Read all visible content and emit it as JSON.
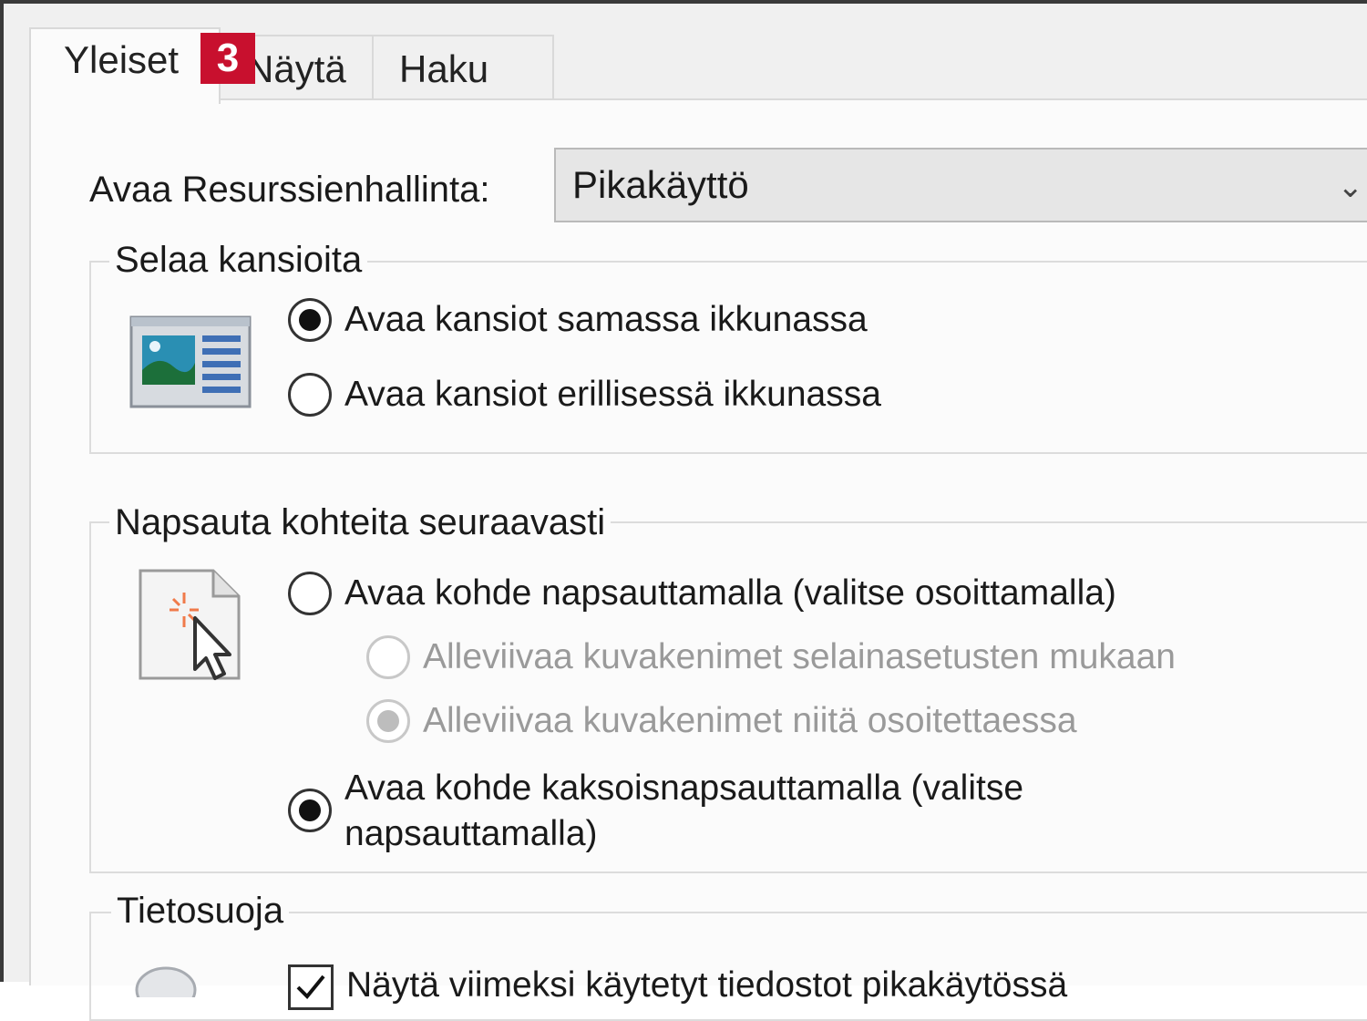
{
  "tabs": [
    {
      "label": "Yleiset",
      "active": true
    },
    {
      "label": "Näytä",
      "active": false
    },
    {
      "label": "Haku",
      "active": false
    }
  ],
  "badge": "3",
  "open_explorer": {
    "label": "Avaa Resurssienhallinta:",
    "selected": "Pikakäyttö"
  },
  "browse_folders": {
    "legend": "Selaa kansioita",
    "icon": "folder-window-icon",
    "options": [
      {
        "label": "Avaa kansiot samassa ikkunassa",
        "checked": true
      },
      {
        "label": "Avaa kansiot erillisessä ikkunassa",
        "checked": false
      }
    ]
  },
  "click_items": {
    "legend": "Napsauta kohteita seuraavasti",
    "icon": "pointer-click-icon",
    "single_click": {
      "label": "Avaa kohde napsauttamalla (valitse osoittamalla)",
      "checked": false
    },
    "sub_options": [
      {
        "label": "Alleviivaa kuvakenimet selainasetusten mukaan",
        "checked": false,
        "disabled": true
      },
      {
        "label": "Alleviivaa kuvakenimet niitä osoitettaessa",
        "checked": true,
        "disabled": true
      }
    ],
    "double_click": {
      "line1": "Avaa kohde kaksoisnapsauttamalla (valitse",
      "line2": "napsauttamalla)",
      "checked": true
    }
  },
  "privacy": {
    "legend": "Tietosuoja",
    "checkbox_label": "Näytä viimeksi käytetyt tiedostot pikakäytössä",
    "checked": true
  },
  "colors": {
    "badge": "#c8102e",
    "panel": "#fbfbfb",
    "chrome": "#f0f0f0"
  }
}
